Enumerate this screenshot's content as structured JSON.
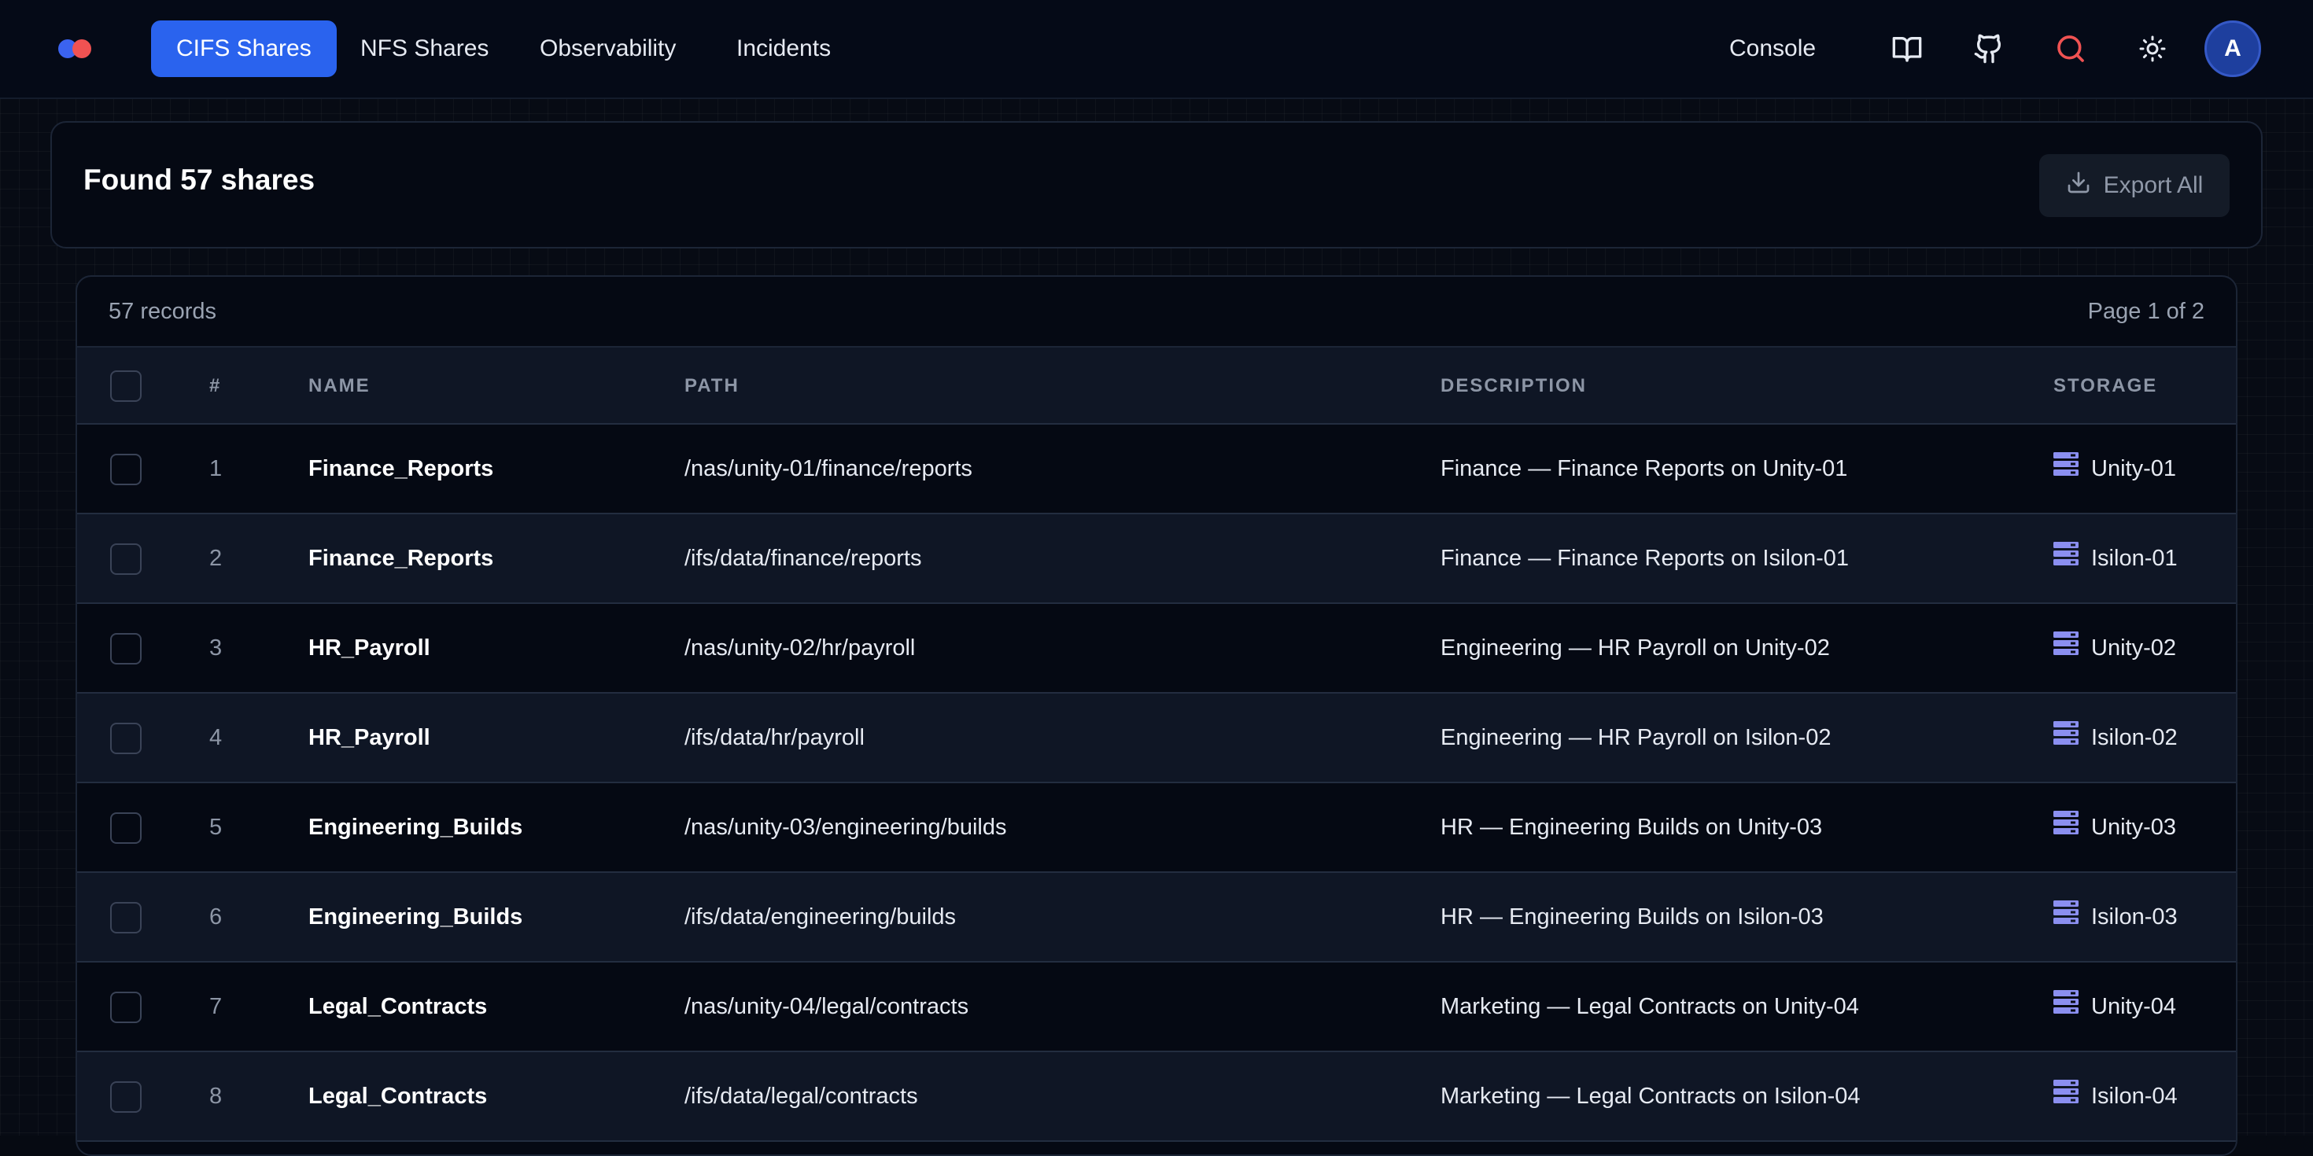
{
  "nav": {
    "tabs": [
      {
        "label": "CIFS Shares",
        "active": true
      },
      {
        "label": "NFS Shares",
        "active": false
      },
      {
        "label": "Observability",
        "active": false
      },
      {
        "label": "Incidents",
        "active": false
      }
    ],
    "console_label": "Console",
    "icons": [
      "book-icon",
      "github-icon",
      "search-icon",
      "sun-icon"
    ],
    "avatar_initial": "A"
  },
  "header": {
    "title": "Found 57 shares",
    "export_label": "Export All"
  },
  "table": {
    "records_label": "57 records",
    "page_label": "Page 1 of 2",
    "columns": {
      "num": "#",
      "name": "NAME",
      "path": "PATH",
      "description": "DESCRIPTION",
      "storage": "STORAGE"
    },
    "rows": [
      {
        "num": "1",
        "name": "Finance_Reports",
        "path": "/nas/unity-01/finance/reports",
        "description": "Finance — Finance Reports on Unity-01",
        "storage": "Unity-01"
      },
      {
        "num": "2",
        "name": "Finance_Reports",
        "path": "/ifs/data/finance/reports",
        "description": "Finance — Finance Reports on Isilon-01",
        "storage": "Isilon-01"
      },
      {
        "num": "3",
        "name": "HR_Payroll",
        "path": "/nas/unity-02/hr/payroll",
        "description": "Engineering — HR Payroll on Unity-02",
        "storage": "Unity-02"
      },
      {
        "num": "4",
        "name": "HR_Payroll",
        "path": "/ifs/data/hr/payroll",
        "description": "Engineering — HR Payroll on Isilon-02",
        "storage": "Isilon-02"
      },
      {
        "num": "5",
        "name": "Engineering_Builds",
        "path": "/nas/unity-03/engineering/builds",
        "description": "HR — Engineering Builds on Unity-03",
        "storage": "Unity-03"
      },
      {
        "num": "6",
        "name": "Engineering_Builds",
        "path": "/ifs/data/engineering/builds",
        "description": "HR — Engineering Builds on Isilon-03",
        "storage": "Isilon-03"
      },
      {
        "num": "7",
        "name": "Legal_Contracts",
        "path": "/nas/unity-04/legal/contracts",
        "description": "Marketing — Legal Contracts on Unity-04",
        "storage": "Unity-04"
      },
      {
        "num": "8",
        "name": "Legal_Contracts",
        "path": "/ifs/data/legal/contracts",
        "description": "Marketing — Legal Contracts on Isilon-04",
        "storage": "Isilon-04"
      }
    ]
  },
  "colors": {
    "accent": "#2a63ee",
    "storage_icon": "#8b8ff0",
    "search_icon": "#f05252"
  }
}
